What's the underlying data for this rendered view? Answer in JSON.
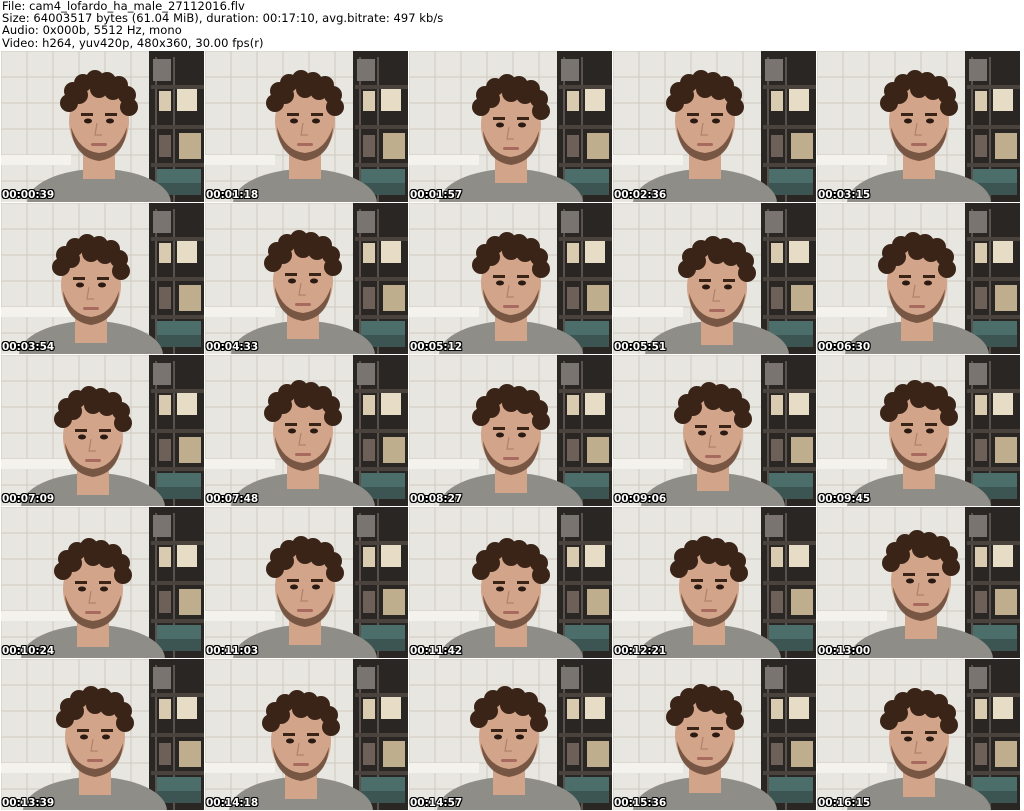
{
  "header": {
    "line1": "File: cam4_lofardo_ha_male_27112016.flv",
    "line2": "Size: 64003517 bytes (61.04 MiB), duration: 00:17:10, avg.bitrate: 497 kb/s",
    "line3": "Audio: 0x000b, 5512 Hz, mono",
    "line4": "Video: h264, yuv420p, 480x360, 30.00 fps(r)"
  },
  "thumbnails": [
    {
      "timestamp": "00:00:39"
    },
    {
      "timestamp": "00:01:18"
    },
    {
      "timestamp": "00:01:57"
    },
    {
      "timestamp": "00:02:36"
    },
    {
      "timestamp": "00:03:15"
    },
    {
      "timestamp": "00:03:54"
    },
    {
      "timestamp": "00:04:33"
    },
    {
      "timestamp": "00:05:12"
    },
    {
      "timestamp": "00:05:51"
    },
    {
      "timestamp": "00:06:30"
    },
    {
      "timestamp": "00:07:09"
    },
    {
      "timestamp": "00:07:48"
    },
    {
      "timestamp": "00:08:27"
    },
    {
      "timestamp": "00:09:06"
    },
    {
      "timestamp": "00:09:45"
    },
    {
      "timestamp": "00:10:24"
    },
    {
      "timestamp": "00:11:03"
    },
    {
      "timestamp": "00:11:42"
    },
    {
      "timestamp": "00:12:21"
    },
    {
      "timestamp": "00:13:00"
    },
    {
      "timestamp": "00:13:39"
    },
    {
      "timestamp": "00:14:18"
    },
    {
      "timestamp": "00:14:57"
    },
    {
      "timestamp": "00:15:36"
    },
    {
      "timestamp": "00:16:15"
    }
  ],
  "colors": {
    "wall_tile": "#e8e6e0",
    "grout": "#cfcac0",
    "shelf_dark": "#2a2624",
    "shelf_light": "#e7dcc6",
    "skin": "#d2a48a",
    "hair": "#3a2418",
    "shirt": "#8e8d87",
    "timestamp_text": "#ffffff"
  }
}
